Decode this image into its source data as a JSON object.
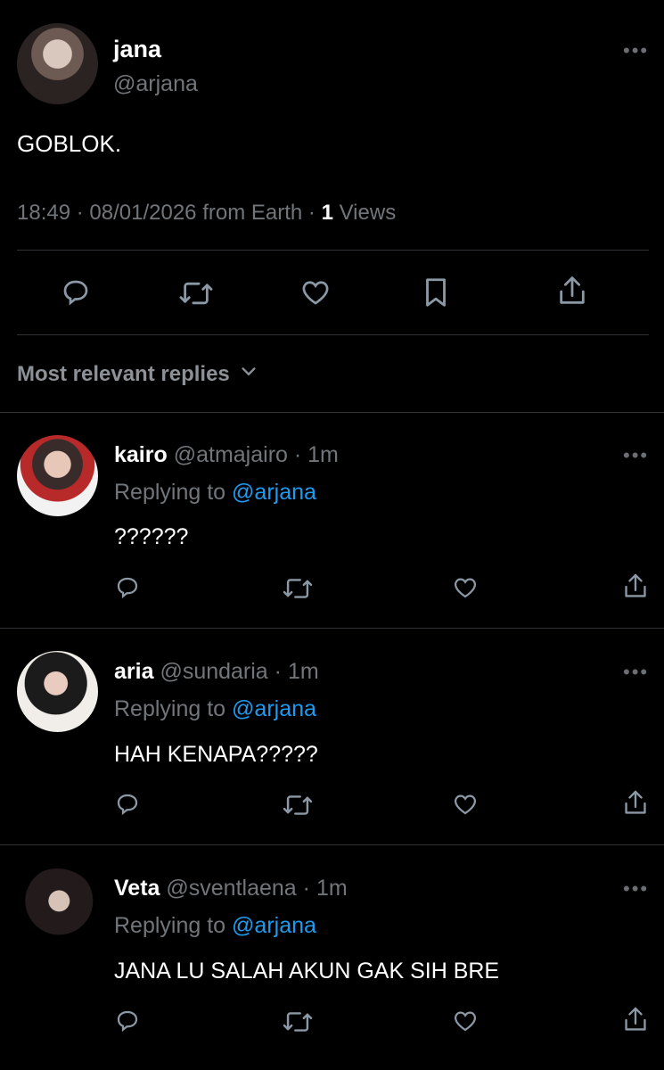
{
  "tweet": {
    "author_name": "jana",
    "author_handle": "@arjana",
    "text": "GOBLOK.",
    "time": "18:49",
    "date": "08/01/2026",
    "source": "from Earth",
    "views_count": "1",
    "views_label": "Views",
    "separator": "·"
  },
  "replies_filter_label": "Most relevant replies",
  "replying_to_label": "Replying to",
  "replies": [
    {
      "name": "kairo",
      "handle": "@atmajairo",
      "time": "1m",
      "replying_to": "@arjana",
      "text": "??????"
    },
    {
      "name": "aria",
      "handle": "@sundaria",
      "time": "1m",
      "replying_to": "@arjana",
      "text": "HAH KENAPA?????"
    },
    {
      "name": "Veta",
      "handle": "@sventlaena",
      "time": "1m",
      "replying_to": "@arjana",
      "text": "JANA LU SALAH AKUN GAK SIH BRE"
    }
  ],
  "icons": {
    "more": "more-horizontal-icon",
    "reply": "reply-icon",
    "retweet": "retweet-icon",
    "like": "heart-icon",
    "bookmark": "bookmark-icon",
    "share": "share-icon",
    "chevron": "chevron-down-icon"
  },
  "colors": {
    "background": "#000000",
    "text": "#e7e9ea",
    "muted": "#71767b",
    "link": "#1d9bf0",
    "divider": "#2f3336"
  }
}
